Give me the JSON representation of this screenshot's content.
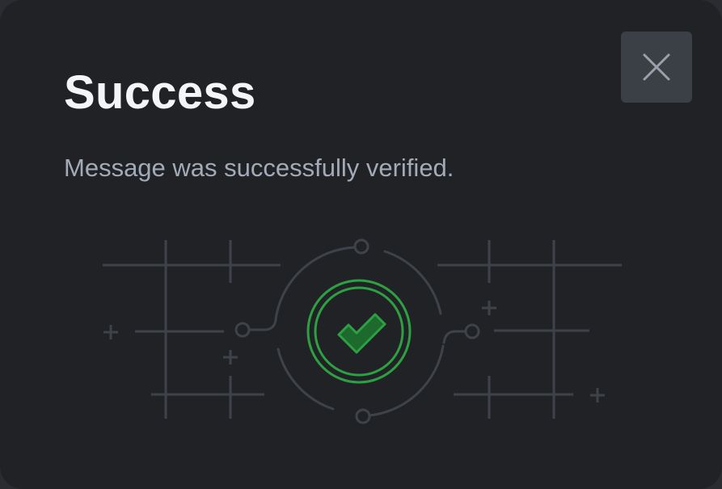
{
  "dialog": {
    "title": "Success",
    "message": "Message was successfully verified.",
    "close_icon": "close-icon",
    "status_icon": "check-circle-icon",
    "colors": {
      "background": "#212226",
      "title": "#f3f5f8",
      "message": "#a3abb8",
      "close_button": "#3b3f46",
      "circuit_lines": "#3e434a",
      "success": "#2ea043"
    }
  }
}
